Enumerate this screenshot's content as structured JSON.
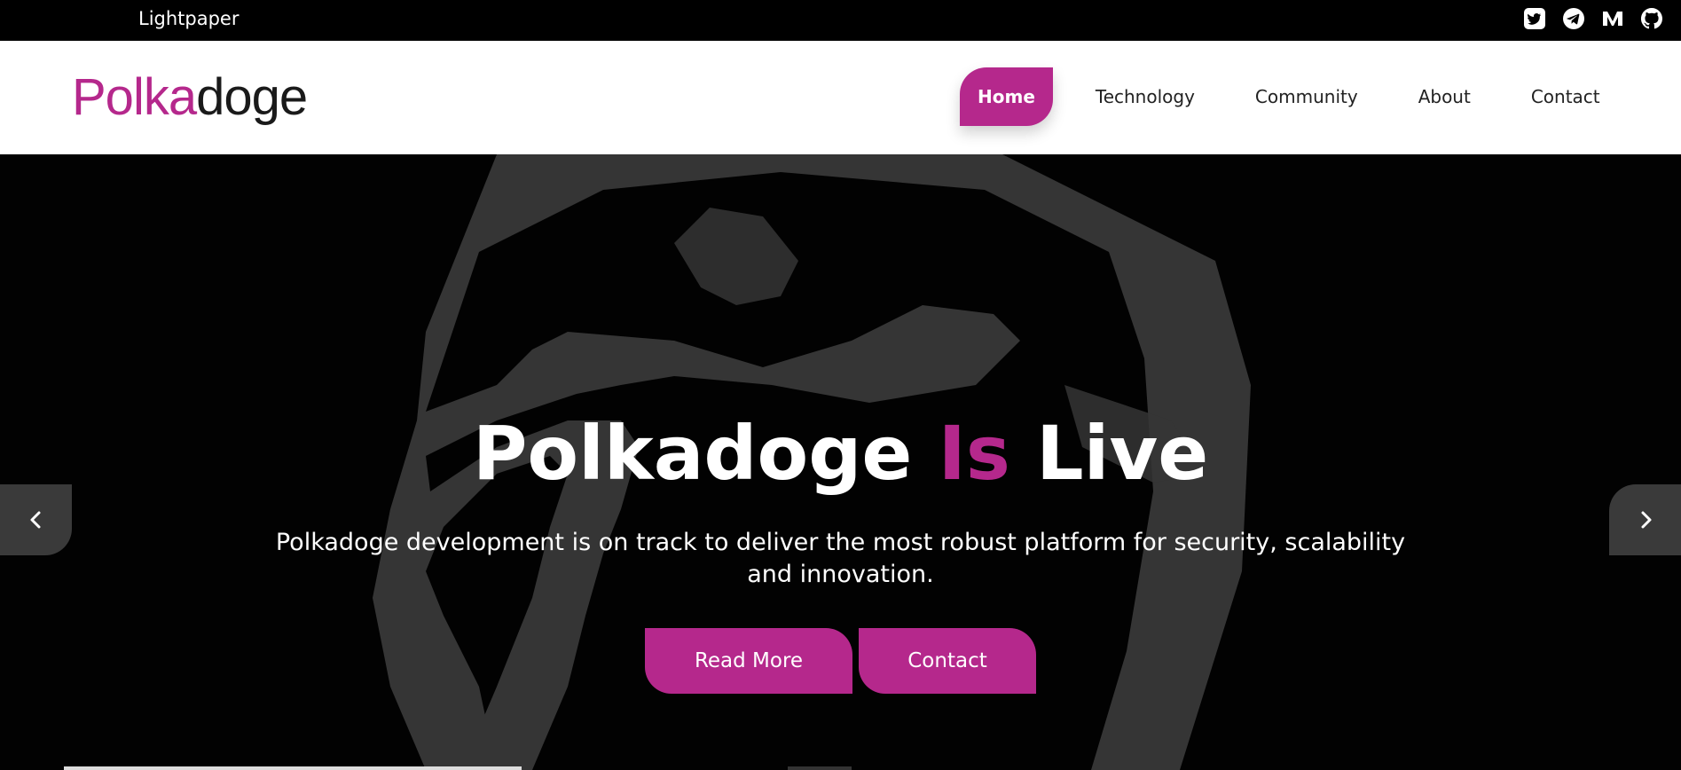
{
  "topbar": {
    "lightpaper": "Lightpaper",
    "social": [
      "twitter-icon",
      "telegram-icon",
      "medium-icon",
      "github-icon"
    ]
  },
  "brand": {
    "logo_part1": "Polka",
    "logo_part2": "doge",
    "accent_color": "#b5288c"
  },
  "nav": {
    "items": [
      {
        "label": "Home",
        "active": true
      },
      {
        "label": "Technology"
      },
      {
        "label": "Community"
      },
      {
        "label": "About"
      },
      {
        "label": "Contact"
      }
    ]
  },
  "hero": {
    "title_pre": "Polkadoge ",
    "title_accent": "Is",
    "title_post": " Live",
    "subtitle": "Polkadoge development is on track to deliver the most robust platform for security, scalability and innovation.",
    "read_more": "Read More",
    "contact": "Contact"
  }
}
